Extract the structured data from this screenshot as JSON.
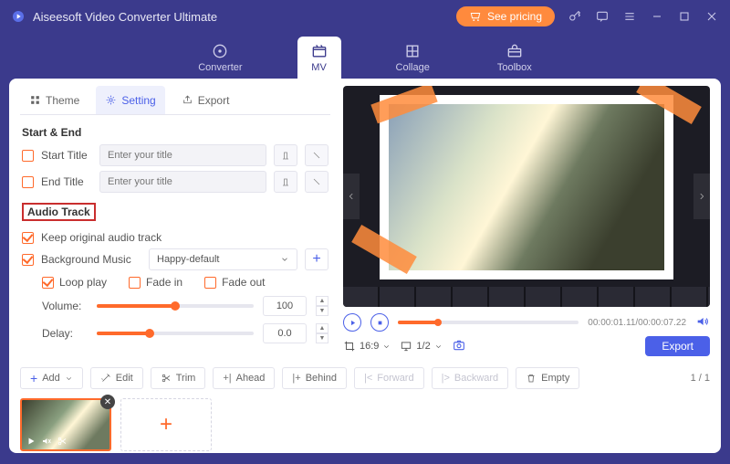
{
  "app": {
    "title": "Aiseesoft Video Converter Ultimate"
  },
  "titlebar": {
    "see_pricing": "See pricing"
  },
  "nav": {
    "converter": "Converter",
    "mv": "MV",
    "collage": "Collage",
    "toolbox": "Toolbox"
  },
  "tabs": {
    "theme": "Theme",
    "setting": "Setting",
    "export": "Export"
  },
  "sections": {
    "start_end": "Start & End",
    "start_title": "Start Title",
    "end_title": "End Title",
    "placeholder": "Enter your title",
    "audio_track": "Audio Track",
    "keep_original": "Keep original audio track",
    "bg_music": "Background Music",
    "bg_music_sel": "Happy-default",
    "loop": "Loop play",
    "fade_in": "Fade in",
    "fade_out": "Fade out",
    "volume_label": "Volume:",
    "volume_value": "100",
    "delay_label": "Delay:",
    "delay_value": "0.0"
  },
  "player": {
    "time_current": "00:00:01.11",
    "time_total": "00:00:07.22",
    "aspect": "16:9",
    "zoom": "1/2",
    "export": "Export"
  },
  "tools": {
    "add": "Add",
    "edit": "Edit",
    "trim": "Trim",
    "ahead": "Ahead",
    "behind": "Behind",
    "forward": "Forward",
    "backward": "Backward",
    "empty": "Empty",
    "page": "1 / 1"
  }
}
